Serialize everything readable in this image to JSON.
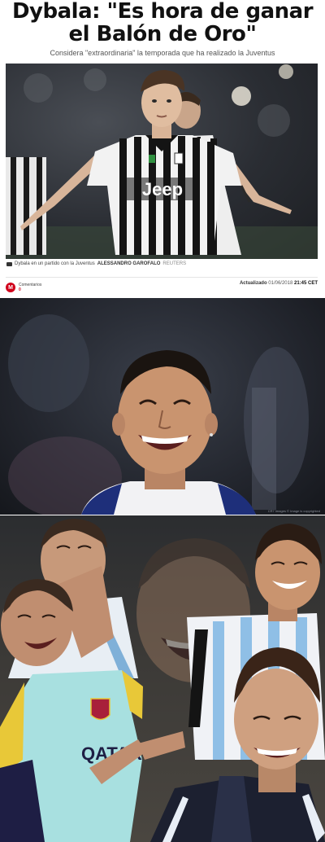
{
  "article": {
    "headline": "Dybala: \"Es hora de ganar el Balón de Oro\"",
    "subhead": "Considera \"extraordinaria\" la temporada que ha realizado la Juventus",
    "caption": "Dybala en un partido con la Juventus",
    "caption_credit": "ALESSANDRO GAROFALO",
    "caption_credit_2": "REUTERS",
    "brand_logo": "M",
    "comments_label": "Comentarios",
    "comments_count": "0",
    "updated_label": "Actualizado",
    "updated_date": "01/06/2018",
    "updated_time": "21:45 CET",
    "shirt_sponsor": "Jeep"
  },
  "panel2": {
    "watermark": "CR7 Images © Image is copyrighted"
  },
  "panel3": {
    "shirt_sponsor": "QATAR"
  },
  "colors": {
    "brand_red": "#d0021b",
    "panel_dark": "#23262e"
  },
  "icons": [
    "camera-icon",
    "brand-logo-icon"
  ]
}
